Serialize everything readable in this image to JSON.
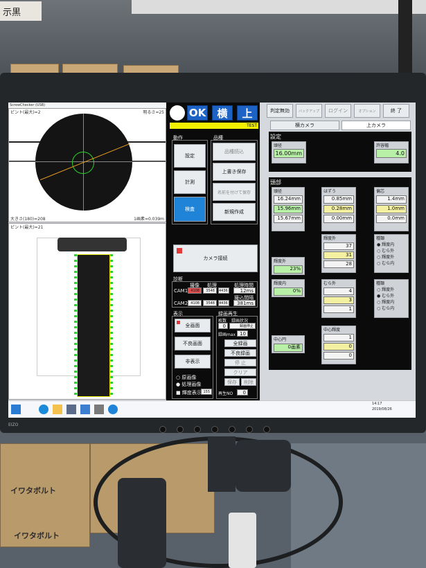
{
  "environment": {
    "shelf_label": "示黒",
    "box_label_1": "イワタボルト",
    "box_label_2": "イワタボルト"
  },
  "monitor": {
    "brand": "EIZO"
  },
  "app": {
    "title": "ScrewChecker (USB)",
    "camera_top": {
      "header_left": "ピント(最大)=2",
      "header_right": "明るさ=25",
      "footer_left": "大きさ(180)=208",
      "footer_right": "1画素=0.039m"
    },
    "camera_side": {
      "header_left": "ピント(最大)=21"
    },
    "status": {
      "ok": "OK",
      "yoko": "横",
      "ue": "上",
      "test": "TEST"
    },
    "dousa": {
      "title": "動作",
      "buttons": [
        "設定",
        "計測",
        "検査"
      ]
    },
    "hinshu": {
      "title": "品種",
      "buttons": [
        "品種読込",
        "上書き保存",
        "名前を付けて保存",
        "新規作成"
      ]
    },
    "camera_connect": "カメラ接続",
    "shindan": {
      "title": "診断",
      "headers": [
        "撮像",
        "処理",
        "処理時間"
      ],
      "cam1": {
        "label": "CAM1",
        "v1": "4108",
        "v2": "3548",
        "v3": "4436",
        "time": "12ms"
      },
      "interval_label": "撮込間隔",
      "cam2": {
        "label": "CAM2",
        "v1": "4108",
        "v2": "3548",
        "v3": "4436",
        "interval": "381ms"
      }
    },
    "hyouji": {
      "title": "表示",
      "buttons": [
        "全画面",
        "不良画面",
        "非表示"
      ],
      "radio": [
        "原画像",
        "処理画像"
      ],
      "check": "輝度表示",
      "check_val": "155"
    },
    "rokuga": {
      "title": "録画再生",
      "cols": [
        "枚数",
        "録画状況"
      ],
      "count": "0",
      "state": "録画停止",
      "max_label": "録画max",
      "max_val": "10",
      "buttons": [
        "全録画",
        "不良録画",
        "停 止",
        "クリア",
        "保存",
        "削除"
      ],
      "replay_label": "再生NO",
      "replay_val": "0"
    },
    "top_buttons": [
      "判定無効",
      "バックアップ",
      "ログイン",
      "オプション",
      "終 了"
    ],
    "cam_tabs": [
      "横カメラ",
      "上カメラ"
    ],
    "settei": {
      "title": "設定",
      "diameter_label": "頭径",
      "diameter_val": "16.00mm",
      "tolerance_label": "許容幅",
      "tolerance_val": "4.0"
    },
    "toubu": {
      "title": "頭部",
      "kei": {
        "label": "頭径",
        "v": [
          "16.24mm",
          "15.96mm",
          "15.67mm"
        ]
      },
      "hazure": {
        "label": "はずう",
        "v": [
          "0.85mm",
          "0.28mm",
          "0.00mm"
        ]
      },
      "henshin": {
        "label": "偏芯",
        "v": [
          "1.4mm",
          "1.0mm",
          "0.0mm"
        ]
      },
      "kido_gai": {
        "label": "輝度外",
        "v": [
          "37",
          "31",
          "28"
        ]
      },
      "kido_gai_pct": {
        "label": "輝度外",
        "v": "23%"
      },
      "kido_nai": {
        "label": "輝度内",
        "v": "0%"
      },
      "mura_gai": {
        "label": "むら外",
        "v": [
          "4",
          "3",
          "1"
        ]
      },
      "chushin_kido": {
        "label": "中心輝度",
        "v": [
          "1",
          "0",
          "0"
        ]
      },
      "chushin_en": {
        "label": "中心円",
        "v": "0画素"
      },
      "shubetsu1": {
        "label": "種類",
        "options": [
          "輝度内",
          "むら外",
          "輝度外",
          "むら内"
        ]
      },
      "shubetsu2": {
        "label": "種類",
        "options": [
          "輝度外",
          "むら外",
          "輝度内",
          "むら内"
        ]
      }
    },
    "taskbar": {
      "time": "14:17",
      "date": "2019/08/26"
    }
  }
}
